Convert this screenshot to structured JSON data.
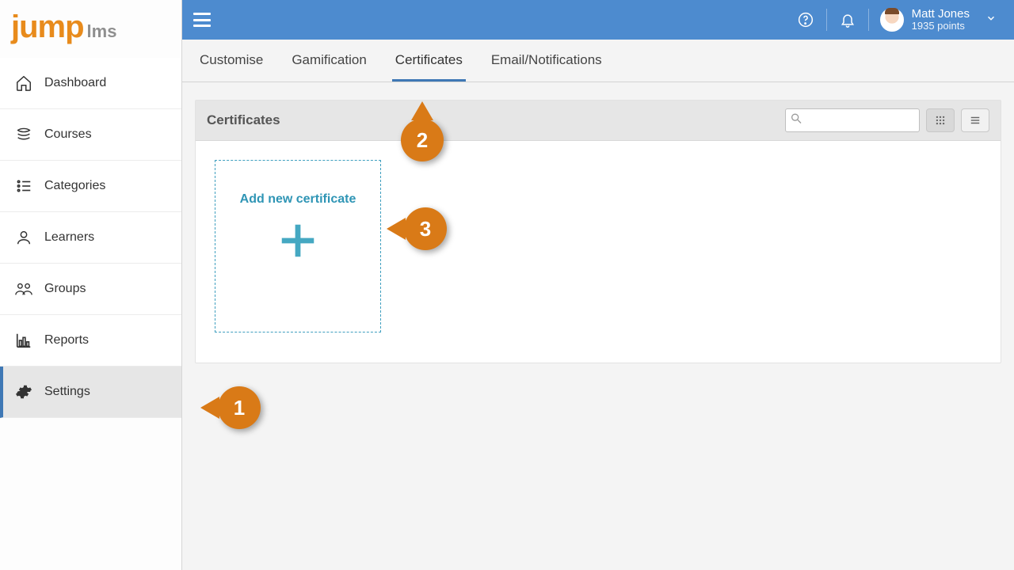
{
  "logo": {
    "text_main": "jump",
    "text_sub": "lms"
  },
  "sidebar": {
    "items": [
      {
        "label": "Dashboard",
        "icon": "home-icon"
      },
      {
        "label": "Courses",
        "icon": "stack-icon"
      },
      {
        "label": "Categories",
        "icon": "list-icon"
      },
      {
        "label": "Learners",
        "icon": "person-icon"
      },
      {
        "label": "Groups",
        "icon": "people-icon"
      },
      {
        "label": "Reports",
        "icon": "barchart-icon"
      },
      {
        "label": "Settings",
        "icon": "gear-icon"
      }
    ],
    "active_index": 6
  },
  "topbar": {
    "user_name": "Matt Jones",
    "user_points": "1935 points"
  },
  "tabs": {
    "items": [
      {
        "label": "Customise"
      },
      {
        "label": "Gamification"
      },
      {
        "label": "Certificates"
      },
      {
        "label": "Email/Notifications"
      }
    ],
    "active_index": 2
  },
  "panel": {
    "title": "Certificates",
    "search_value": "",
    "tile_label": "Add new certificate"
  },
  "callouts": {
    "c1": "1",
    "c2": "2",
    "c3": "3"
  }
}
